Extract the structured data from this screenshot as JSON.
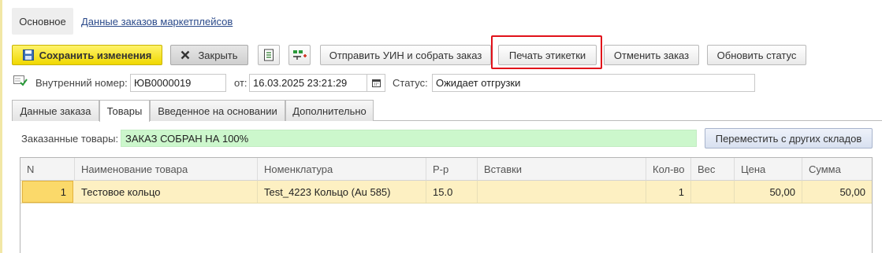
{
  "nav": {
    "main_tab": "Основное",
    "marketplace_link": "Данные заказов маркетплейсов"
  },
  "toolbar": {
    "save": "Сохранить изменения",
    "close": "Закрыть",
    "send_uin": "Отправить УИН и собрать заказ",
    "print_labels": "Печать этикетки",
    "cancel_order": "Отменить заказ",
    "update_status": "Обновить статус",
    "icons": [
      "save-icon",
      "close-x-icon",
      "report-icon",
      "add-structure-icon"
    ]
  },
  "header": {
    "internal_number_label": "Внутренний номер:",
    "internal_number": "ЮВ0000019",
    "date_label": "от:",
    "date": "16.03.2025 23:21:29",
    "status_label": "Статус:",
    "status": "Ожидает отгрузки"
  },
  "tabs": [
    "Данные заказа",
    "Товары",
    "Введенное на основании",
    "Дополнительно"
  ],
  "active_tab": "Товары",
  "goods": {
    "ordered_label": "Заказанные товары:",
    "progress_text": "ЗАКАЗ СОБРАН НА 100%",
    "progress_percent": 100,
    "move_button": "Переместить с других складов"
  },
  "table": {
    "columns": [
      "N",
      "Наименование товара",
      "Номенклатура",
      "Р-р",
      "Вставки",
      "Кол-во",
      "Вес",
      "Цена",
      "Сумма"
    ],
    "rows": [
      [
        "1",
        "Тестовое кольцо",
        "Test_4223 Кольцо (Au 585)",
        "15.0",
        "",
        "1",
        "",
        "50,00",
        "50,00"
      ]
    ]
  },
  "colors": {
    "accent_yellow": "#f7e33a",
    "highlight_red": "#e1111a",
    "progress_green": "#ccf7cc",
    "row_selected": "#fdf0c2"
  }
}
